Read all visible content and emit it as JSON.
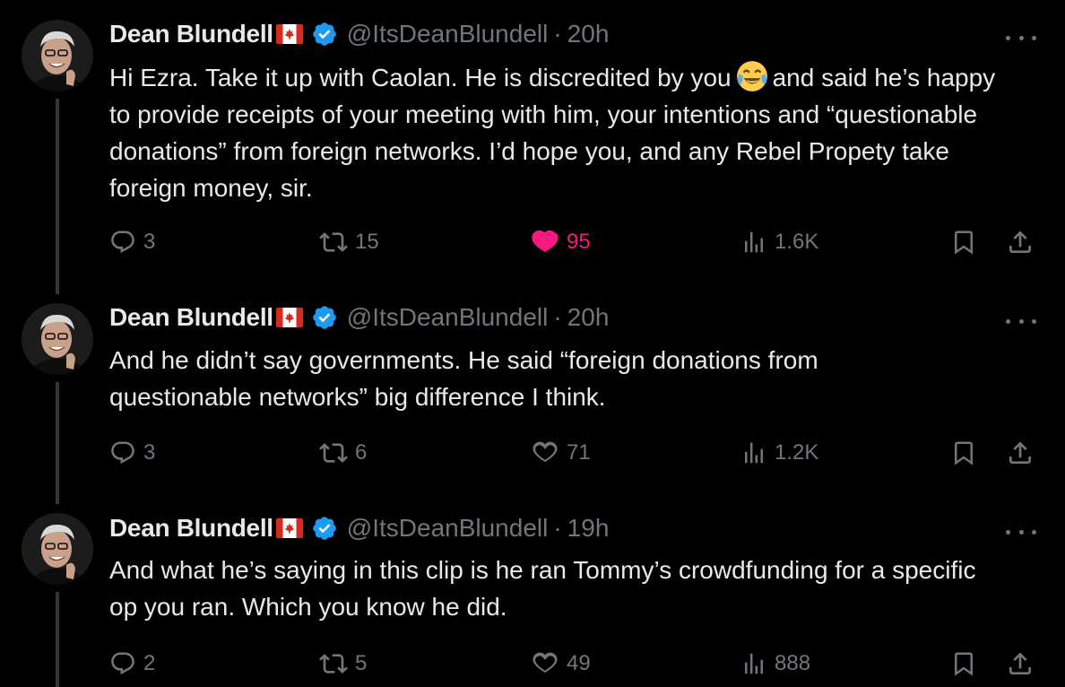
{
  "tweets": [
    {
      "author": "Dean Blundell",
      "handle": "@ItsDeanBlundell",
      "time": "20h",
      "text_before_emoji": "Hi Ezra. Take it up with Caolan. He is discredited by you",
      "text_after_emoji": "and said he’s happy to provide receipts of your meeting with him, your intentions and “questionable donations” from foreign networks. I’d hope you, and any Rebel Propety take foreign money, sir.",
      "replies": "3",
      "reposts": "15",
      "likes": "95",
      "views": "1.6K",
      "liked": true
    },
    {
      "author": "Dean Blundell",
      "handle": "@ItsDeanBlundell",
      "time": "20h",
      "text": "And he didn’t say governments. He said “foreign donations from questionable networks” big difference I think.",
      "replies": "3",
      "reposts": "6",
      "likes": "71",
      "views": "1.2K",
      "liked": false
    },
    {
      "author": "Dean Blundell",
      "handle": "@ItsDeanBlundell",
      "time": "19h",
      "text": "And what he’s saying in this clip is he ran Tommy’s crowdfunding for a specific op you ran. Which you know he did.",
      "replies": "2",
      "reposts": "5",
      "likes": "49",
      "views": "888",
      "liked": false
    }
  ],
  "separator": "·",
  "colors": {
    "background": "#000000",
    "text": "#e7e9ea",
    "muted": "#71767b",
    "like": "#f91880",
    "verified": "#1d9bf0",
    "thread_line": "#333639"
  },
  "icons": [
    "canada-flag-icon",
    "verified-badge-icon",
    "face-with-tears-of-joy-emoji",
    "more-icon",
    "reply-icon",
    "repost-icon",
    "like-icon",
    "views-icon",
    "bookmark-icon",
    "share-icon"
  ]
}
